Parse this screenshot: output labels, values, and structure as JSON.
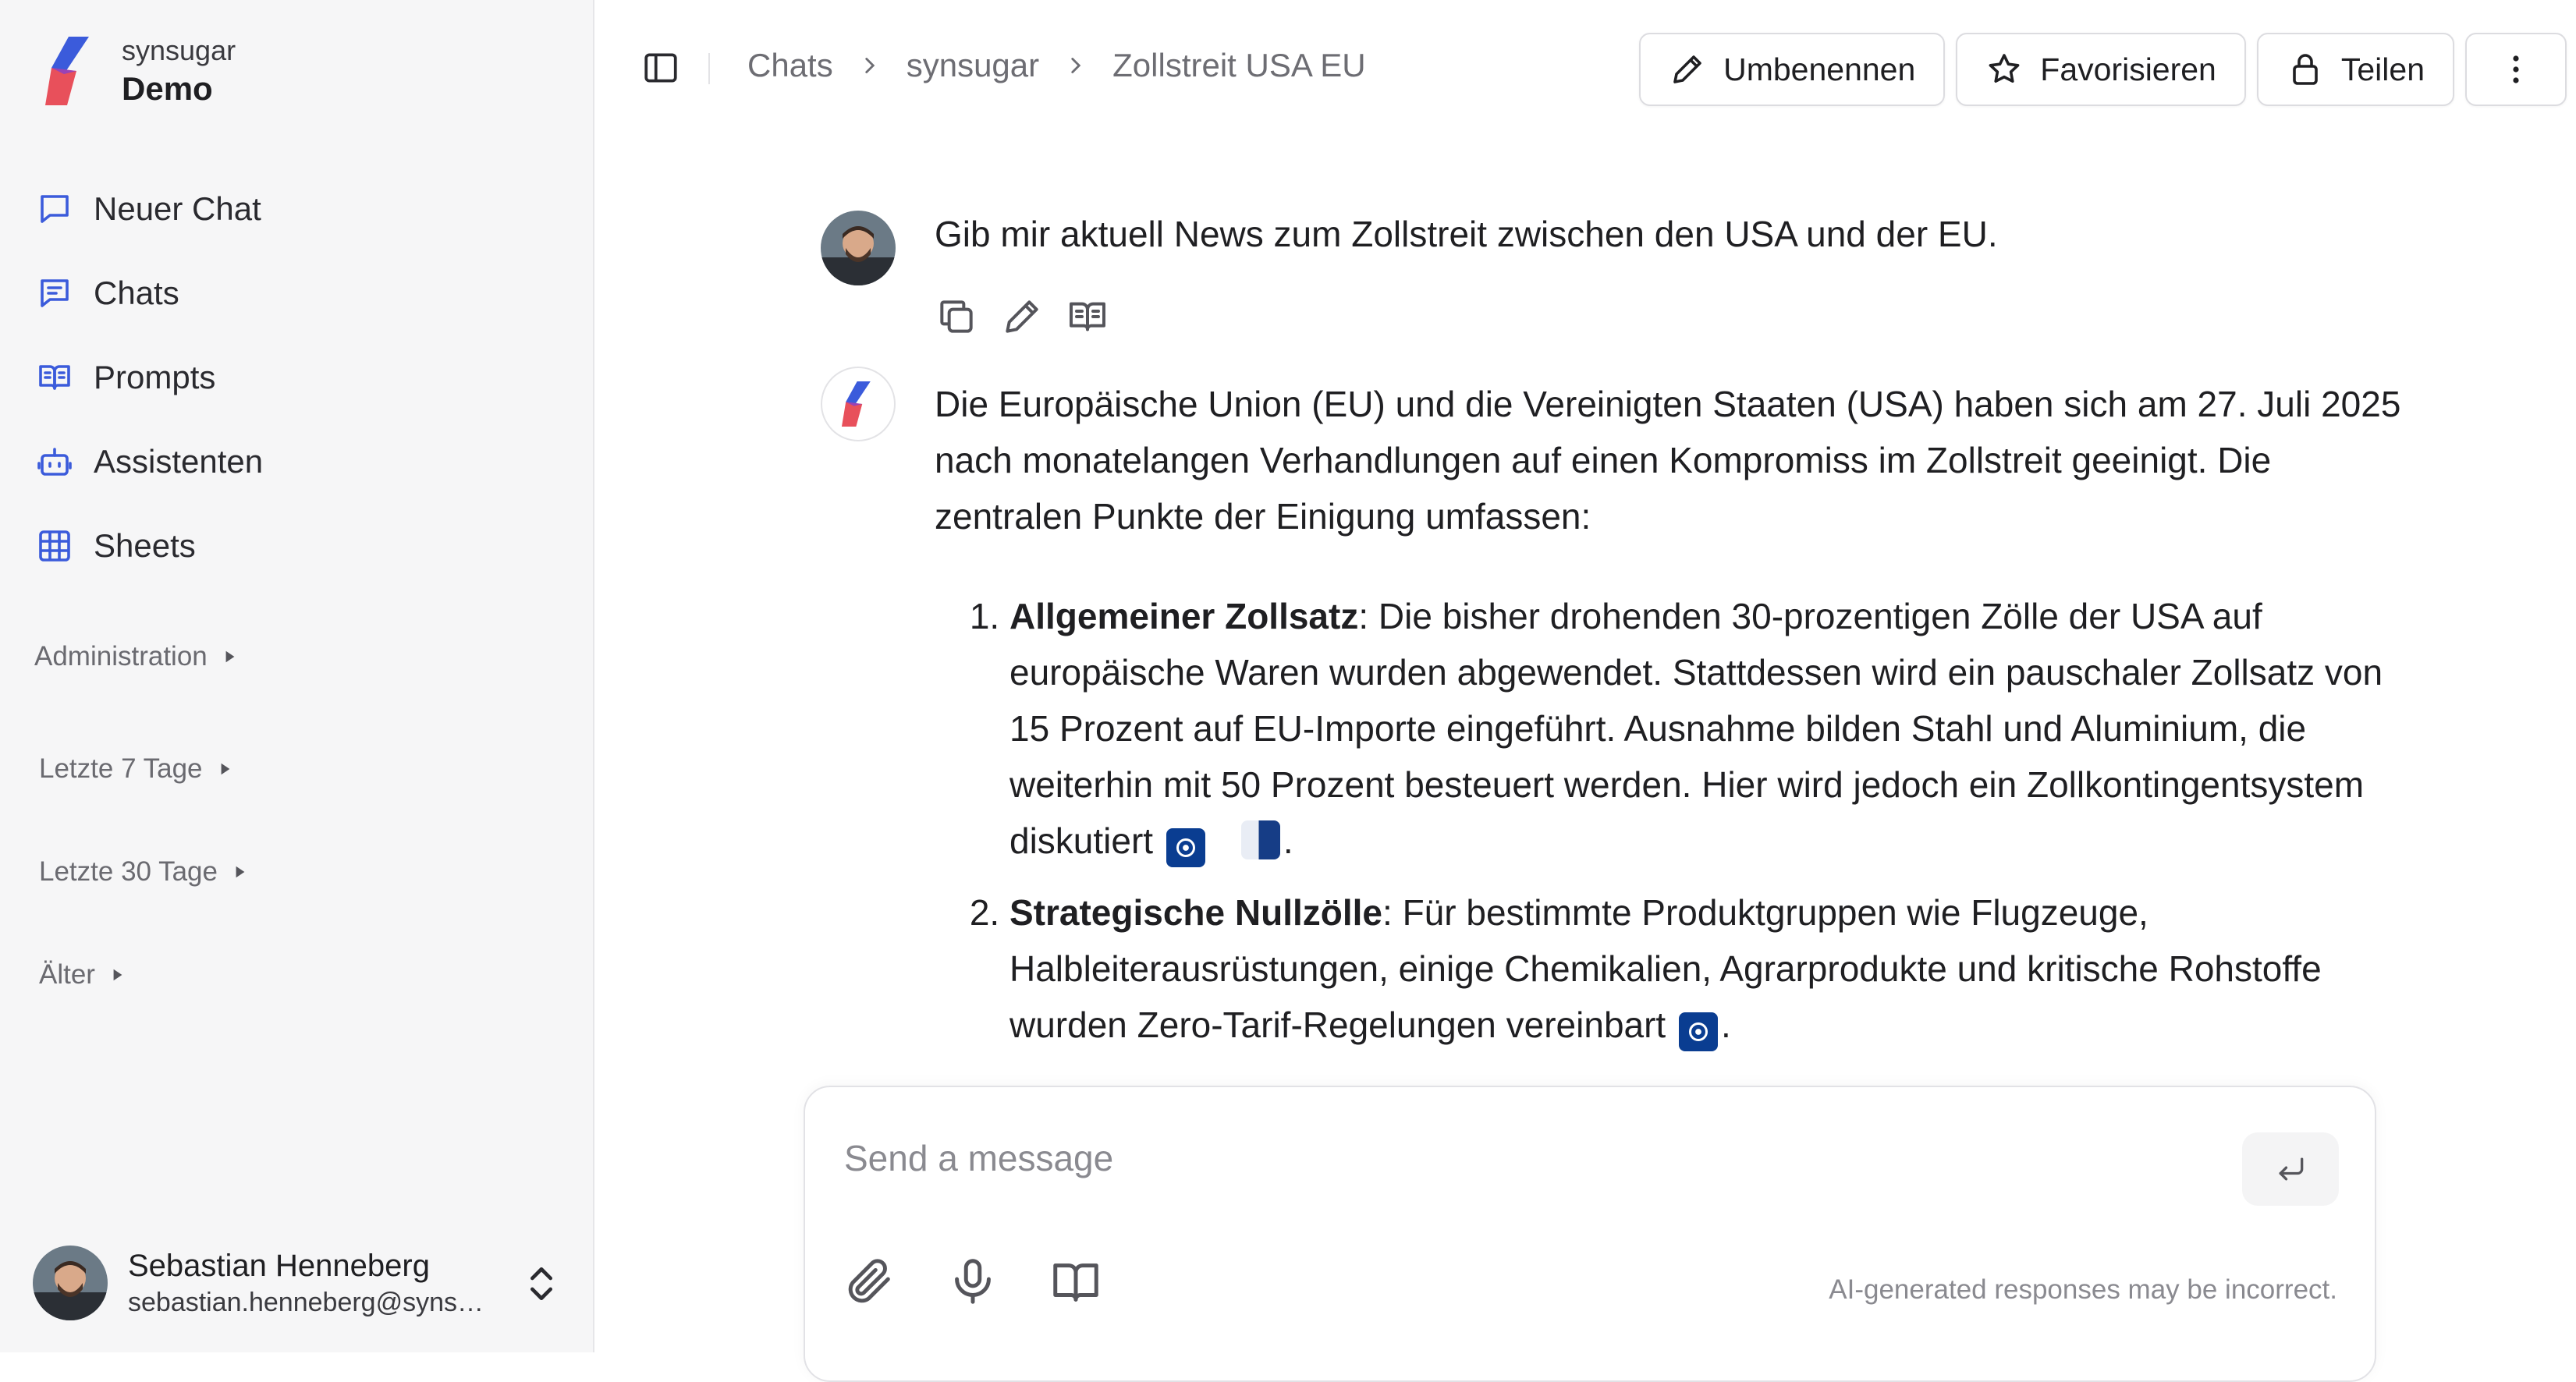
{
  "brand": {
    "org": "synsugar",
    "workspace": "Demo"
  },
  "nav": {
    "items": [
      {
        "label": "Neuer Chat",
        "icon": "message-square-icon"
      },
      {
        "label": "Chats",
        "icon": "message-lines-icon"
      },
      {
        "label": "Prompts",
        "icon": "book-open-icon"
      },
      {
        "label": "Assistenten",
        "icon": "bot-icon"
      },
      {
        "label": "Sheets",
        "icon": "table-icon"
      }
    ]
  },
  "sections": {
    "administration": "Administration",
    "last7": "Letzte 7 Tage",
    "last30": "Letzte 30 Tage",
    "older": "Älter"
  },
  "user": {
    "name": "Sebastian Henneberg",
    "email": "sebastian.henneberg@synsugar.com"
  },
  "breadcrumb": [
    "Chats",
    "synsugar",
    "Zollstreit USA EU"
  ],
  "actions": {
    "rename": "Umbenennen",
    "favorite": "Favorisieren",
    "share": "Teilen"
  },
  "conversation": {
    "user_message": "Gib mir aktuell News zum Zollstreit zwischen den USA und der EU.",
    "assistant_intro": "Die Europäische Union (EU) und die Vereinigten Staaten (USA) haben sich am 27. Juli 2025 nach monatelangen Verhandlungen auf einen Kompromiss im Zollstreit geeinigt. Die zentralen Punkte der Einigung umfassen:",
    "points": [
      {
        "title": "Allgemeiner Zollsatz",
        "text": ": Die bisher drohenden 30-prozentigen Zölle der USA auf europäische Waren wurden abgewendet. Stattdessen wird ein pauschaler Zollsatz von 15 Prozent auf EU-Importe eingeführt. Ausnahme bilden Stahl und Aluminium, die weiterhin mit 50 Prozent besteuert werden. Hier wird jedoch ein Zollkontingentsystem diskutiert"
      },
      {
        "title": "Strategische Nullzölle",
        "text": ": Für bestimmte Produktgruppen wie Flugzeuge, Halbleiterausrüstungen, einige Chemikalien, Agrarprodukte und kritische Rohstoffe wurden Zero-Tarif-Regelungen vereinbart"
      }
    ],
    "period": "."
  },
  "composer": {
    "placeholder": "Send a message",
    "disclaimer": "AI-generated responses may be incorrect."
  },
  "colors": {
    "accent_blue": "#3b5bdb",
    "brand_red": "#e8505b",
    "source_badge": "#0a3d91"
  }
}
